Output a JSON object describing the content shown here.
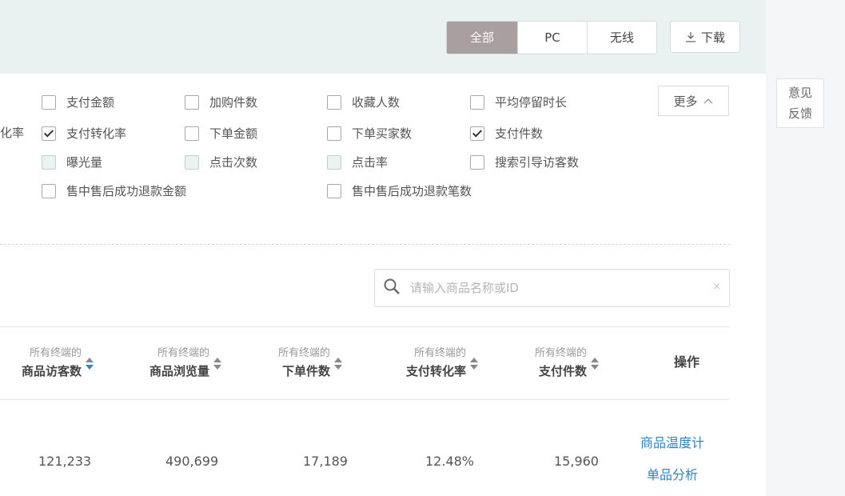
{
  "toolbar": {
    "segments": [
      "全部",
      "PC",
      "无线"
    ],
    "active_segment": "全部",
    "download_label": "下载"
  },
  "metrics": {
    "cut_label": "化率",
    "items": [
      {
        "label": "支付金额",
        "checked": false
      },
      {
        "label": "加购件数",
        "checked": false
      },
      {
        "label": "收藏人数",
        "checked": false
      },
      {
        "label": "平均停留时长",
        "checked": false
      },
      {
        "label": "支付转化率",
        "checked": true
      },
      {
        "label": "下单金额",
        "checked": false
      },
      {
        "label": "下单买家数",
        "checked": false
      },
      {
        "label": "支付件数",
        "checked": true
      },
      {
        "label": "曝光量",
        "checked": false
      },
      {
        "label": "点击次数",
        "checked": false
      },
      {
        "label": "点击率",
        "checked": false
      },
      {
        "label": "搜索引导访客数",
        "checked": false
      },
      {
        "label": "售中售后成功退款金额",
        "checked": false
      },
      {
        "label": "售中售后成功退款笔数",
        "checked": false
      }
    ],
    "more_label": "更多"
  },
  "search": {
    "placeholder": "请输入商品名称或ID",
    "clear": "×"
  },
  "table": {
    "columns": [
      {
        "sub": "所有终端的",
        "label": "商品访客数"
      },
      {
        "sub": "所有终端的",
        "label": "商品浏览量"
      },
      {
        "sub": "所有终端的",
        "label": "下单件数"
      },
      {
        "sub": "所有终端的",
        "label": "支付转化率"
      },
      {
        "sub": "所有终端的",
        "label": "支付件数"
      }
    ],
    "op_header": "操作",
    "row": {
      "values": [
        "121,233",
        "490,699",
        "17,189",
        "12.48%",
        "15,960"
      ],
      "actions": [
        "商品温度计",
        "单品分析"
      ]
    }
  },
  "feedback": {
    "line1": "意见",
    "line2": "反馈"
  },
  "colors": {
    "accent_link": "#2d83c5",
    "active_segment_bg": "#a99ea0"
  }
}
